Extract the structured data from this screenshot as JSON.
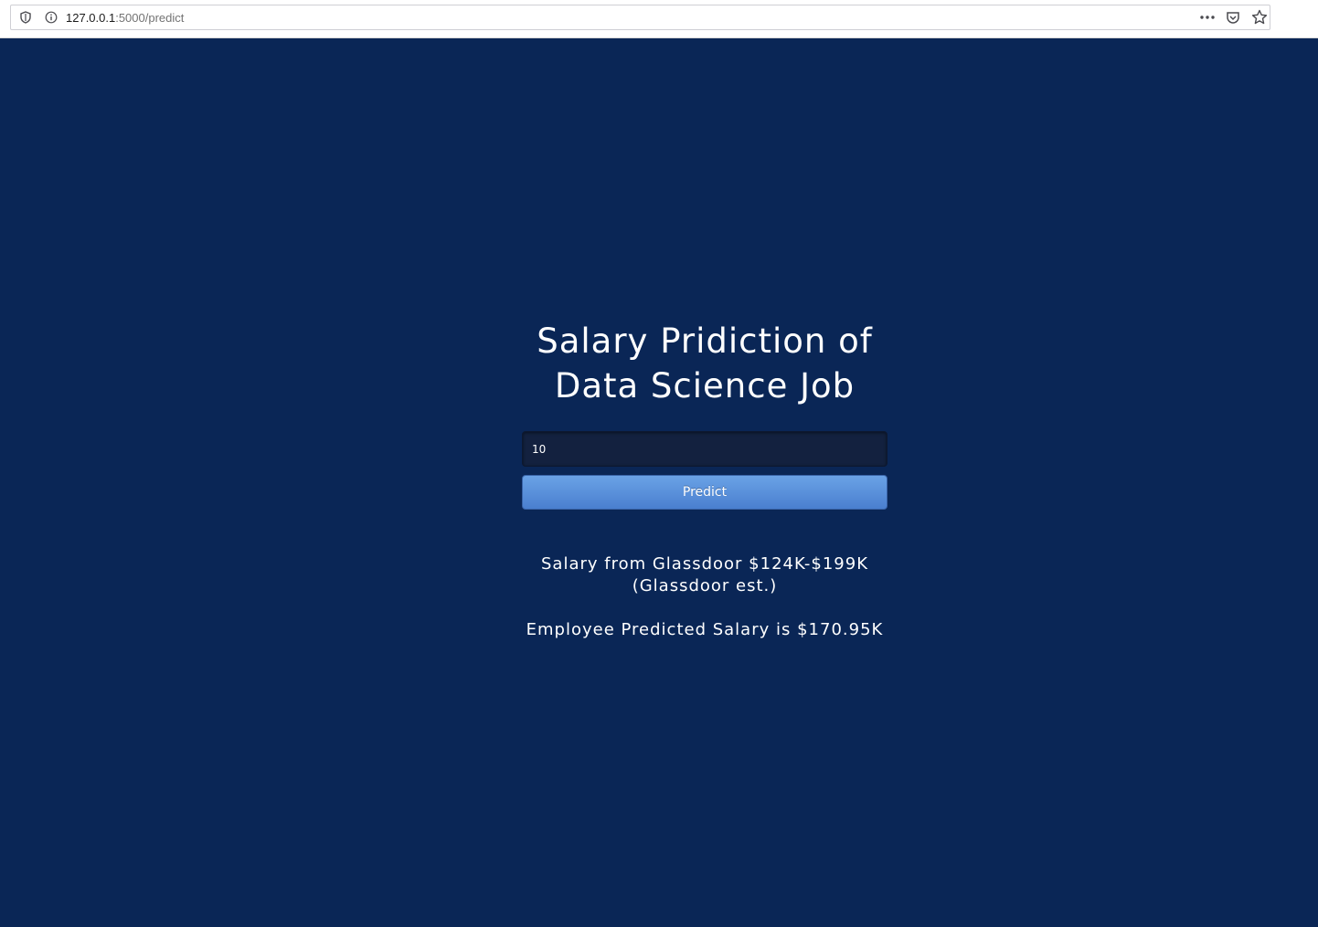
{
  "browser": {
    "url_host": "127.0.0.1",
    "url_path": ":5000/predict"
  },
  "page": {
    "title_line1": "Salary Pridiction of",
    "title_line2": "Data Science Job",
    "input_value": "10",
    "predict_label": "Predict",
    "glassdoor_line1": "Salary from Glassdoor $124K-$199K",
    "glassdoor_line2": "(Glassdoor est.)",
    "predicted_text": "Employee Predicted Salary is $170.95K"
  },
  "colors": {
    "background": "#0a2656",
    "button": "#5a8fdb",
    "input_bg": "#13213f"
  }
}
